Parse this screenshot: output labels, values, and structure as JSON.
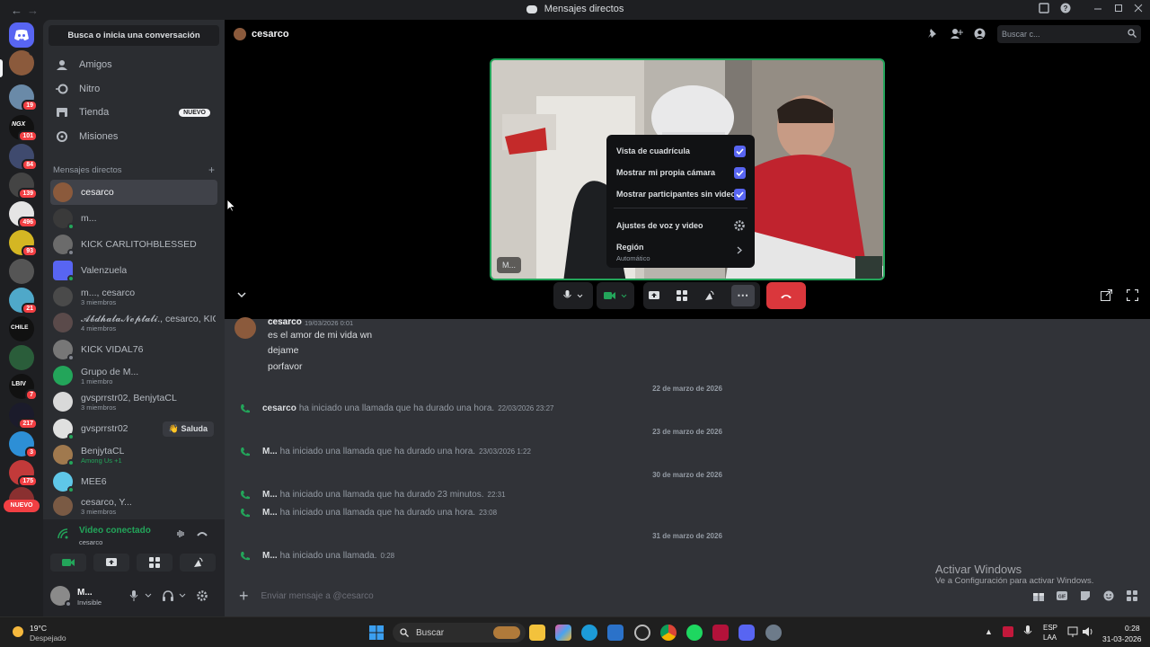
{
  "window": {
    "title": "Mensajes directos",
    "back": "←",
    "forward": "→"
  },
  "rail": {
    "badges": [
      "19",
      "101",
      "84",
      "139",
      "496",
      "93",
      "21",
      "7",
      "217",
      "3",
      "175"
    ],
    "nuevo": "NUEVO",
    "labels": [
      "NGX",
      "CHILE",
      "LBIV"
    ]
  },
  "sidebar": {
    "search": "Busca o inicia una conversación",
    "nav": [
      {
        "label": "Amigos",
        "icon": "friends-icon"
      },
      {
        "label": "Nitro",
        "icon": "nitro-icon"
      },
      {
        "label": "Tienda",
        "icon": "shop-icon",
        "badge": "NUEVO"
      },
      {
        "label": "Misiones",
        "icon": "quests-icon"
      }
    ],
    "dm_header": "Mensajes directos",
    "dm_add": "+",
    "dms": [
      {
        "name": "cesarco",
        "sub": ""
      },
      {
        "name": "m...",
        "sub": ""
      },
      {
        "name": "KICK CARLITOHBLESSED",
        "sub": ""
      },
      {
        "name": "Valenzuela",
        "sub": ""
      },
      {
        "name": "m..., cesarco",
        "sub": "3 miembros"
      },
      {
        "name": "𝓐𝓫𝓭𝓱𝓪𝓵𝓪𝓝𝓮𝓹𝓽𝓪𝓵𝓲., cesarco, KIC...",
        "sub": "4 miembros"
      },
      {
        "name": "KICK VIDAL76",
        "sub": ""
      },
      {
        "name": "Grupo de M...",
        "sub": "1 miembro"
      },
      {
        "name": "gvsprrstr02, BenjytaCL",
        "sub": "3 miembros"
      },
      {
        "name": "gvsprrstr02",
        "sub": "",
        "action": "Saluda"
      },
      {
        "name": "BenjytaCL",
        "sub": "Among Us +1"
      },
      {
        "name": "MEE6",
        "sub": ""
      },
      {
        "name": "cesarco, Y...",
        "sub": "3 miembros"
      }
    ]
  },
  "voice": {
    "status": "Video conectado",
    "channel": "cesarco"
  },
  "user": {
    "name": "M...",
    "status": "Invisible"
  },
  "header": {
    "channel": "cesarco",
    "search_placeholder": "Buscar c..."
  },
  "call": {
    "video_tag": "M...",
    "popup": {
      "items": [
        {
          "label": "Vista de cuadrícula",
          "checked": true
        },
        {
          "label": "Mostrar mi propia cámara",
          "checked": true
        },
        {
          "label": "Mostrar participantes sin video",
          "checked": true
        }
      ],
      "settings": "Ajustes de voz y video",
      "region_label": "Región",
      "region_value": "Automático"
    }
  },
  "messages": {
    "author": "cesarco",
    "author_ts": "19/03/2026 0:01",
    "lines": [
      "es el amor de mi vida wn",
      "dejame",
      "porfavor"
    ],
    "events": [
      {
        "date": "22 de marzo de 2026",
        "calls": [
          {
            "who": "cesarco",
            "text": "ha iniciado una llamada que ha durado una hora.",
            "ts": "22/03/2026 23:27"
          }
        ]
      },
      {
        "date": "23 de marzo de 2026",
        "calls": [
          {
            "who": "M...",
            "text": "ha iniciado una llamada que ha durado una hora.",
            "ts": "23/03/2026 1:22"
          }
        ]
      },
      {
        "date": "30 de marzo de 2026",
        "calls": [
          {
            "who": "M...",
            "text": "ha iniciado una llamada que ha durado 23 minutos.",
            "ts": "22:31"
          },
          {
            "who": "M...",
            "text": "ha iniciado una llamada que ha durado una hora.",
            "ts": "23:08"
          }
        ]
      },
      {
        "date": "31 de marzo de 2026",
        "calls": [
          {
            "who": "M...",
            "text": "ha iniciado una llamada.",
            "ts": "0:28"
          }
        ]
      }
    ],
    "compose_placeholder": "Enviar mensaje a @cesarco"
  },
  "activation": {
    "title": "Activar Windows",
    "sub": "Ve a Configuración para activar Windows."
  },
  "taskbar": {
    "weather_temp": "19°C",
    "weather_desc": "Despejado",
    "search": "Buscar",
    "lang": "ESP",
    "lang_sub": "LAA",
    "time": "0:28",
    "date": "31-03-2026"
  },
  "colors": {
    "accent": "#5865f2",
    "green": "#23a55a",
    "red": "#da373c"
  }
}
